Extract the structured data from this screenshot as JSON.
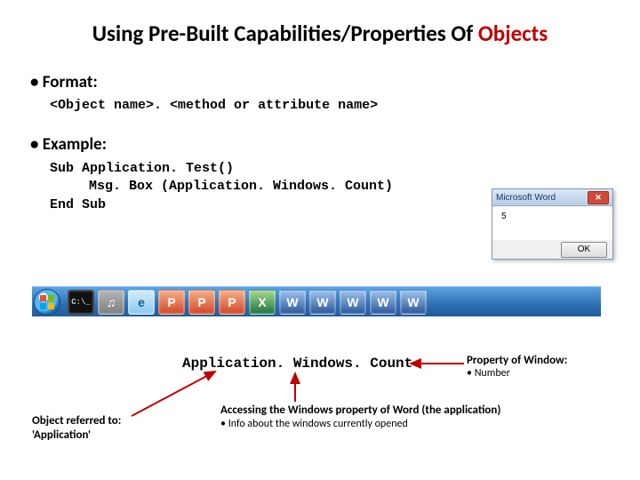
{
  "title_prefix": "Using Pre-Built Capabilities/Properties Of ",
  "title_red": "Objects",
  "bullets": {
    "format": "Format:",
    "example": "Example:"
  },
  "format_code": {
    "obj": "<Object name>",
    "dot": ". ",
    "rest": "<method or attribute name>"
  },
  "code": {
    "l1": "Sub Application. Test()",
    "l2": "Msg. Box (Application. Windows. Count)",
    "l3": "End Sub"
  },
  "msgbox": {
    "title": "Microsoft Word",
    "value": "5",
    "ok": "OK"
  },
  "taskbar_letters": {
    "cm": "♫",
    "ie": "e",
    "p": "P",
    "x": "X",
    "w": "W"
  },
  "expr": "Application. Windows. Count",
  "note_right": {
    "h": "Property of Window:",
    "s": "• Number"
  },
  "note_bl": {
    "l1": "Object referred to:",
    "l2": "'Application'"
  },
  "note_mid": {
    "h": "Accessing the Windows property of Word (the application)",
    "s": "• Info about the windows currently opened"
  }
}
